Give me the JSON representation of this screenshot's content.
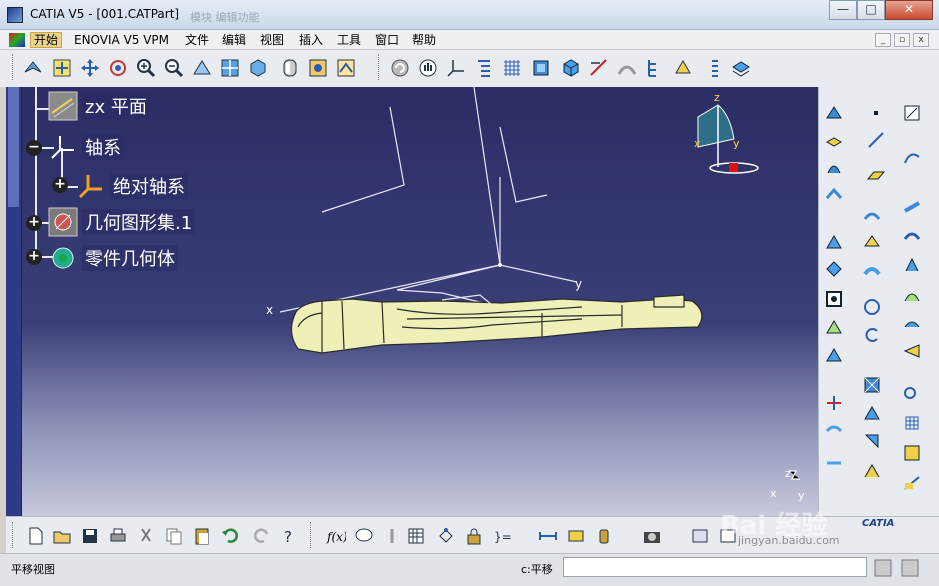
{
  "window": {
    "title": "CATIA V5 - [001.CATPart]",
    "ghost_title": "模块  编辑功能",
    "controls": {
      "minimize": "—",
      "maximize": "□",
      "close": "✕"
    }
  },
  "menubar": {
    "items": [
      "开始",
      "ENOVIA V5 VPM",
      "文件",
      "编辑",
      "视图",
      "插入",
      "工具",
      "窗口",
      "帮助"
    ],
    "active": "开始",
    "mdi": {
      "minimize": "_",
      "restore": "▫",
      "close": "x"
    }
  },
  "tree": {
    "nodes": [
      {
        "label": "zx 平面",
        "icon": "plane-icon"
      },
      {
        "label": "轴系",
        "icon": "axis-system-icon"
      },
      {
        "label": "绝对轴系",
        "icon": "absolute-axis-icon"
      },
      {
        "label": "几何图形集.1",
        "icon": "geometrical-set-icon"
      },
      {
        "label": "零件几何体",
        "icon": "part-body-icon"
      }
    ],
    "expanders": {
      "collapse": "−",
      "expand": "+"
    }
  },
  "viewport": {
    "axis_labels": {
      "x": "x",
      "y": "y"
    },
    "compass_labels": {
      "x": "x",
      "y": "y",
      "z": "z"
    },
    "corner_axis_labels": {
      "x": "x",
      "y": "y",
      "z": "z"
    }
  },
  "statusbar": {
    "message": "平移视图",
    "command_prefix": "c:平移",
    "command_value": ""
  },
  "watermark": {
    "text": "Bai 经验",
    "sub": "jingyan.baidu.com",
    "catia": "CATIA"
  },
  "colors": {
    "viewport_top": "#2b2d64",
    "viewport_bottom": "#c7c9dc",
    "part_fill": "#eef0b8",
    "menu_active": "#e9d28a"
  }
}
